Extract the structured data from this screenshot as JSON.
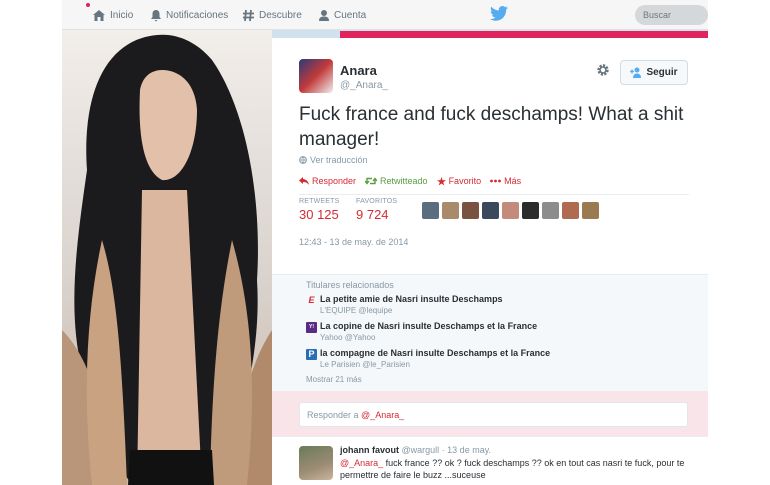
{
  "topnav": {
    "items": [
      {
        "label": "Inicio",
        "icon": "home-icon"
      },
      {
        "label": "Notificaciones",
        "icon": "bell-icon"
      },
      {
        "label": "Descubre",
        "icon": "hashtag-icon"
      },
      {
        "label": "Cuenta",
        "icon": "person-icon"
      }
    ],
    "search_placeholder": "Buscar",
    "logo_icon": "twitter-bird-icon"
  },
  "tweet": {
    "name": "Anara",
    "handle": "@_Anara_",
    "follow_label": "Seguir",
    "text": "Fuck france and fuck deschamps! What a shit manager!",
    "translate_label": "Ver traducción",
    "actions": {
      "reply": "Responder",
      "retweet": "Retwitteado",
      "favorite": "Favorito",
      "more": "Más"
    },
    "stats": {
      "retweets_label": "RETWEETS",
      "retweets_value": "30 125",
      "favorites_label": "FAVORITOS",
      "favorites_value": "9 724"
    },
    "timestamp": "12:43 - 13 de may. de 2014"
  },
  "related": {
    "title": "Titulares relacionados",
    "items": [
      {
        "icon": "lequipe-icon",
        "headline": "La petite amie de Nasri insulte Deschamps",
        "source": "L'EQUIPE @lequipe"
      },
      {
        "icon": "yahoo-icon",
        "headline": "La copine de Nasri insulte Deschamps et la France",
        "source": "Yahoo @Yahoo"
      },
      {
        "icon": "parisien-icon",
        "headline": "la compagne de Nasri insulte Deschamps et la France",
        "source": "Le Parisien @le_Parisien"
      }
    ],
    "show_more": "Mostrar 21 más"
  },
  "reply_box": {
    "prefix": "Responder a ",
    "mention": "@_Anara_"
  },
  "reply_tweet": {
    "name": "johann favout",
    "handle": "@wargull",
    "separator": " · ",
    "date": "13 de may.",
    "mention": "@_Anara_",
    "text": " fuck france ?? ok ? fuck deschamps ?? ok en tout cas nasri te fuck, pour te permettre de faire le buzz ...suceuse"
  },
  "colors": {
    "accent": "#d52a35",
    "retweet_green": "#5c9c41",
    "pink_bar": "#e0245e"
  }
}
